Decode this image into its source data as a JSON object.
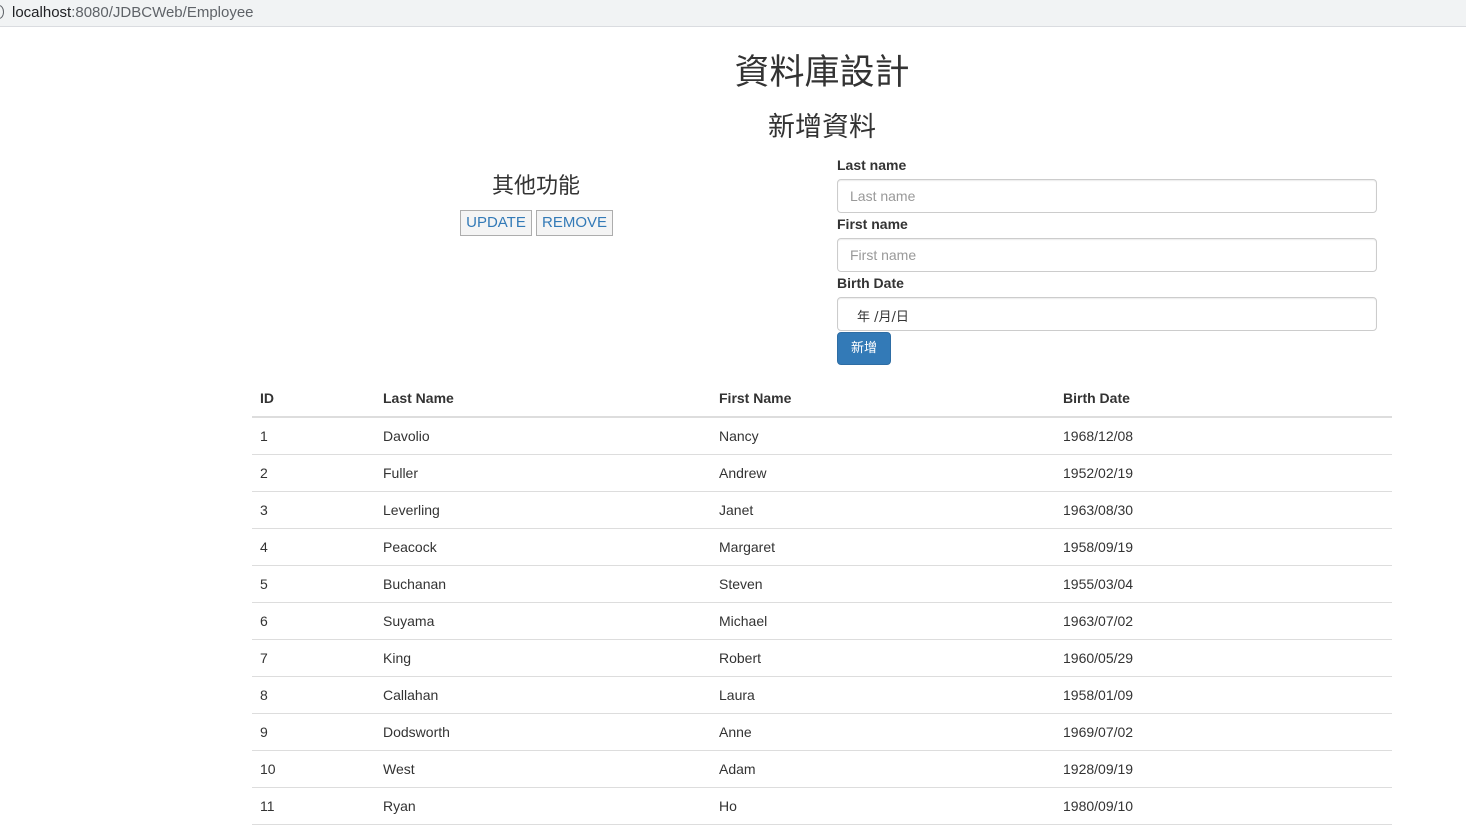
{
  "browser": {
    "url_host": "localhost",
    "url_path": ":8080/JDBCWeb/Employee"
  },
  "page": {
    "title": "資料庫設計",
    "add_section_title": "新增資料",
    "other_section_title": "其他功能"
  },
  "actions": {
    "update_label": "UPDATE",
    "remove_label": "REMOVE",
    "submit_label": "新增"
  },
  "form": {
    "last_name": {
      "label": "Last name",
      "placeholder": "Last name",
      "value": ""
    },
    "first_name": {
      "label": "First name",
      "placeholder": "First name",
      "value": ""
    },
    "birth_date": {
      "label": "Birth Date",
      "display": "年 /月/日"
    }
  },
  "table": {
    "headers": {
      "id": "ID",
      "last_name": "Last Name",
      "first_name": "First Name",
      "birth_date": "Birth Date"
    },
    "rows": [
      {
        "id": "1",
        "last_name": "Davolio",
        "first_name": "Nancy",
        "birth_date": "1968/12/08"
      },
      {
        "id": "2",
        "last_name": "Fuller",
        "first_name": "Andrew",
        "birth_date": "1952/02/19"
      },
      {
        "id": "3",
        "last_name": "Leverling",
        "first_name": "Janet",
        "birth_date": "1963/08/30"
      },
      {
        "id": "4",
        "last_name": "Peacock",
        "first_name": "Margaret",
        "birth_date": "1958/09/19"
      },
      {
        "id": "5",
        "last_name": "Buchanan",
        "first_name": "Steven",
        "birth_date": "1955/03/04"
      },
      {
        "id": "6",
        "last_name": "Suyama",
        "first_name": "Michael",
        "birth_date": "1963/07/02"
      },
      {
        "id": "7",
        "last_name": "King",
        "first_name": "Robert",
        "birth_date": "1960/05/29"
      },
      {
        "id": "8",
        "last_name": "Callahan",
        "first_name": "Laura",
        "birth_date": "1958/01/09"
      },
      {
        "id": "9",
        "last_name": "Dodsworth",
        "first_name": "Anne",
        "birth_date": "1969/07/02"
      },
      {
        "id": "10",
        "last_name": "West",
        "first_name": "Adam",
        "birth_date": "1928/09/19"
      },
      {
        "id": "11",
        "last_name": "Ryan",
        "first_name": "Ho",
        "birth_date": "1980/09/10"
      }
    ]
  }
}
